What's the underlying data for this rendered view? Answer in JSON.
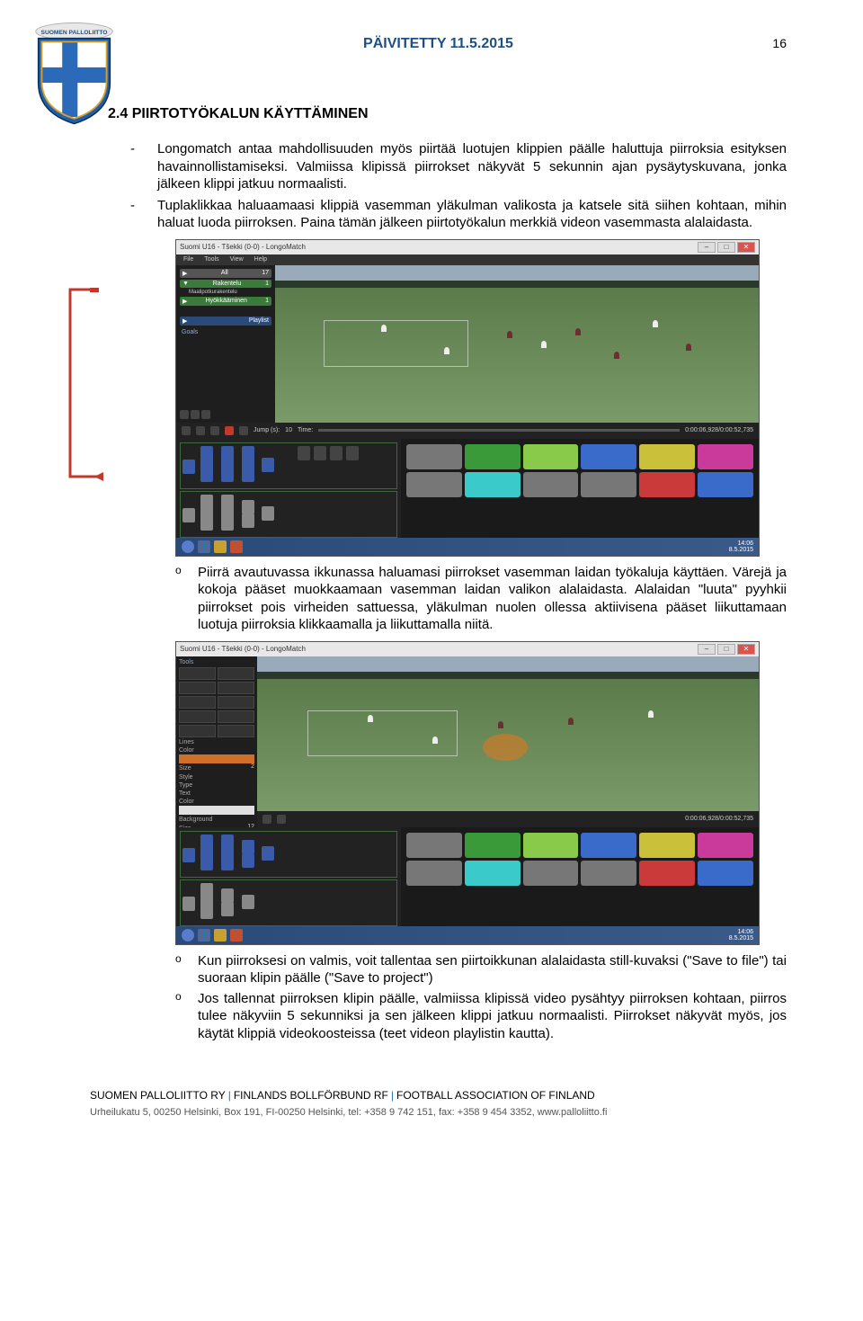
{
  "header": {
    "title": "PÄIVITETTY 11.5.2015",
    "page_number": "16"
  },
  "section": {
    "number": "2.4",
    "title": "PIIRTOTYÖKALUN KÄYTTÄMINEN"
  },
  "bullets": {
    "b1": "Longomatch antaa mahdollisuuden myös piirtää luotujen klippien päälle haluttuja piirroksia esityksen havainnollistamiseksi. Valmiissa klipissä piirrokset näkyvät 5 sekunnin ajan pysäytyskuvana, jonka jälkeen klippi jatkuu normaalisti.",
    "b2": "Tuplaklikkaa haluaamaasi klippiä vasemman yläkulman valikosta ja katsele sitä siihen kohtaan, mihin haluat luoda piirroksen. Paina tämän jälkeen piirtotyökalun merkkiä videon vasemmasta alalaidasta.",
    "s1": "Piirrä avautuvassa ikkunassa haluamasi piirrokset vasemman laidan työkaluja käyttäen. Värejä ja kokoja pääset muokkaamaan vasemman laidan valikon alalaidasta. Alalaidan \"luuta\" pyyhkii piirrokset pois virheiden sattuessa, yläkulman nuolen ollessa aktiivisena pääset liikuttamaan luotuja piirroksia klikkaamalla ja liikuttamalla niitä.",
    "s2": "Kun piirroksesi on valmis, voit tallentaa sen piirtoikkunan alalaidasta still-kuvaksi (\"Save to file\") tai suoraan klipin päälle (\"Save to project\")",
    "s3": "Jos tallennat piirroksen klipin päälle, valmiissa klipissä video pysähtyy piirroksen kohtaan, piirros tulee näkyviin 5 sekunniksi ja sen jälkeen klippi jatkuu normaalisti. Piirrokset näkyvät myös, jos käytät klippiä videokoosteissa (teet videon playlistin kautta)."
  },
  "app": {
    "title": "Suomi U16 - Tšekki (0-0) - LongoMatch",
    "menu": {
      "file": "File",
      "tools": "Tools",
      "view": "View",
      "help": "Help"
    },
    "sidebar": {
      "all": "All",
      "cat1": "Rakentelu",
      "sub1": "Maalipotkurakentelu",
      "cat2": "Hyökkääminen",
      "playlist": "Playlist",
      "goals": "Goals"
    },
    "counts": {
      "all": "17",
      "c1": "1",
      "c2": "1"
    },
    "controls": {
      "jump_label": "Jump (s):",
      "jump_val": "10",
      "time_label": "Time:",
      "stamp": "0:00:06,928/0:00:52,735"
    },
    "save_file": "Save to File",
    "save_proj": "Save to Project",
    "tools": {
      "heading": "Tools",
      "lines": "Lines",
      "color": "Color",
      "size": "Size",
      "size_val": "2",
      "style": "Style",
      "type": "Type",
      "text": "Text",
      "bg": "Background",
      "bg_size": "Size",
      "bg_val": "12"
    },
    "time": "14:06",
    "date": "8.5.2015"
  },
  "footer": {
    "org1": "SUOMEN PALLOLIITTO RY",
    "org2": "FINLANDS BOLLFÖRBUND RF",
    "org3": "FOOTBALL ASSOCIATION OF FINLAND",
    "addr": "Urheilukatu 5, 00250 Helsinki, Box 191, FI-00250 Helsinki, tel: +358 9 742 151, fax: +358 9 454 3352, www.palloliitto.fi"
  }
}
